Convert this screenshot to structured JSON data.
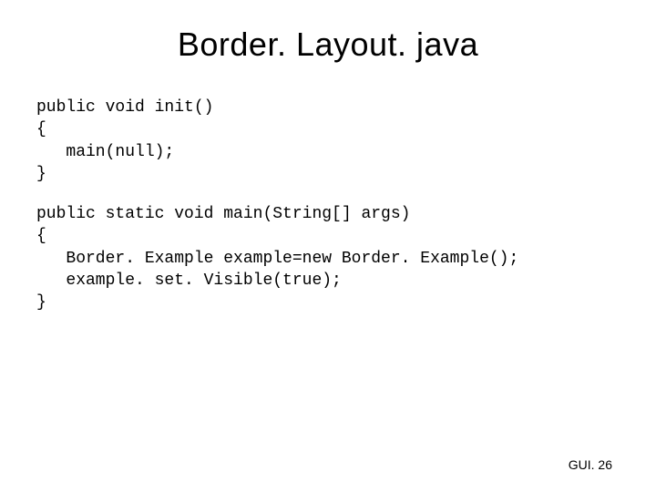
{
  "slide": {
    "title": "Border. Layout. java",
    "code1": "public void init()\n{\n   main(null);\n}",
    "code2": "public static void main(String[] args)\n{\n   Border. Example example=new Border. Example();\n   example. set. Visible(true);\n}",
    "footer": "GUI. 26"
  }
}
